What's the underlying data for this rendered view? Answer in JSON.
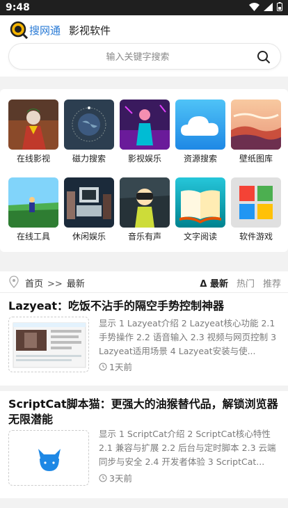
{
  "status_bar": {
    "time": "9:48"
  },
  "header": {
    "brand_name": "搜网通",
    "brand_sub": "影视软件",
    "search_placeholder": "输入关键字搜索"
  },
  "tiles": [
    {
      "label": "在线影视",
      "icon": "joker-poster"
    },
    {
      "label": "磁力搜索",
      "icon": "planet-magnet"
    },
    {
      "label": "影视娱乐",
      "icon": "neon-figure"
    },
    {
      "label": "资源搜索",
      "icon": "cloud-icon"
    },
    {
      "label": "壁纸图库",
      "icon": "sunset-landscape"
    },
    {
      "label": "在线工具",
      "icon": "anime-landscape"
    },
    {
      "label": "休闲娱乐",
      "icon": "retro-computer"
    },
    {
      "label": "音乐有声",
      "icon": "vr-headset-person"
    },
    {
      "label": "文字阅读",
      "icon": "open-book"
    },
    {
      "label": "软件游戏",
      "icon": "windows-logo"
    }
  ],
  "breadcrumb": {
    "home": "首页",
    "sep": ">>",
    "current": "最新",
    "tabs": [
      "Δ 最新",
      "热门",
      "推荐"
    ]
  },
  "posts": [
    {
      "title": "Lazyeat：吃饭不沾手的隔空手势控制神器",
      "summary": "显示 1 Lazyeat介绍 2 Lazyeat核心功能 2.1 手势操作 2.2 语音输入 2.3 视频与网页控制 3 Lazyeat适用场景 4 Lazyeat安装与使...",
      "time": "1天前"
    },
    {
      "title": "ScriptCat脚本猫：更强大的油猴替代品，解锁浏览器无限潜能",
      "summary": "显示 1 ScriptCat介绍 2 ScriptCat核心特性 2.1 兼容与扩展 2.2 后台与定时脚本 2.3 云端同步与安全 2.4 开发者体验 3 ScriptCat...",
      "time": "3天前"
    }
  ],
  "colors": {
    "brand": "#2a7bd6",
    "statusbar": "#1f1f1f"
  }
}
